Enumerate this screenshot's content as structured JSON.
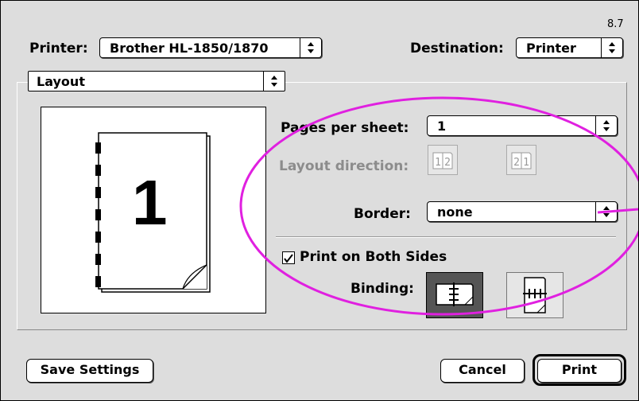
{
  "version": "8.7",
  "printer": {
    "label": "Printer:",
    "value": "Brother HL-1850/1870"
  },
  "destination": {
    "label": "Destination:",
    "value": "Printer"
  },
  "panel_menu": {
    "value": "Layout"
  },
  "preview": {
    "page_number": "1"
  },
  "pages_per_sheet": {
    "label": "Pages per sheet:",
    "value": "1"
  },
  "layout_direction": {
    "label": "Layout direction:",
    "option_1": "12",
    "option_2": "21"
  },
  "border": {
    "label": "Border:",
    "value": "none"
  },
  "both_sides": {
    "label": "Print on Both Sides",
    "checked": true
  },
  "binding": {
    "label": "Binding:"
  },
  "buttons": {
    "save": "Save Settings",
    "cancel": "Cancel",
    "print": "Print"
  },
  "colors": {
    "dialog_bg": "#dddddd",
    "highlight_annotation": "#e020e0",
    "disabled_text": "#8c8c8c"
  }
}
